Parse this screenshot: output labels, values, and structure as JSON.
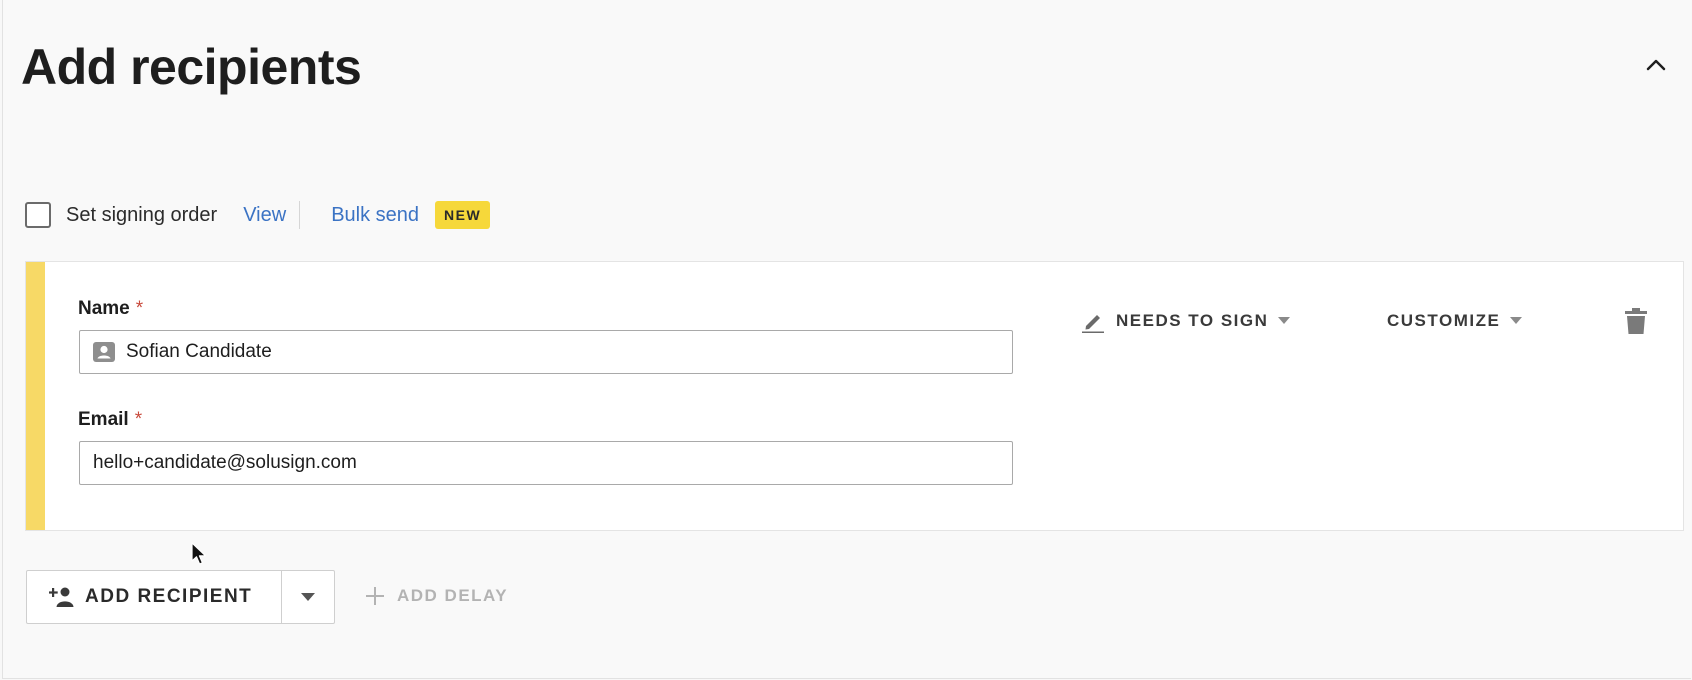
{
  "header": {
    "title": "Add recipients"
  },
  "options": {
    "signing_order_label": "Set signing order",
    "view_link": "View",
    "bulk_send_link": "Bulk send",
    "bulk_send_badge": "NEW"
  },
  "recipient": {
    "name_label": "Name",
    "name_value": "Sofian Candidate",
    "email_label": "Email",
    "email_value": "hello+candidate@solusign.com",
    "required_marker": "*",
    "role_label": "NEEDS TO SIGN",
    "customize_label": "CUSTOMIZE",
    "accent_color": "#f7d966"
  },
  "footer": {
    "add_recipient_label": "ADD RECIPIENT",
    "add_delay_label": "ADD DELAY"
  },
  "colors": {
    "link": "#3b73c4",
    "badge": "#f6d83a",
    "required": "#c84a3c"
  }
}
